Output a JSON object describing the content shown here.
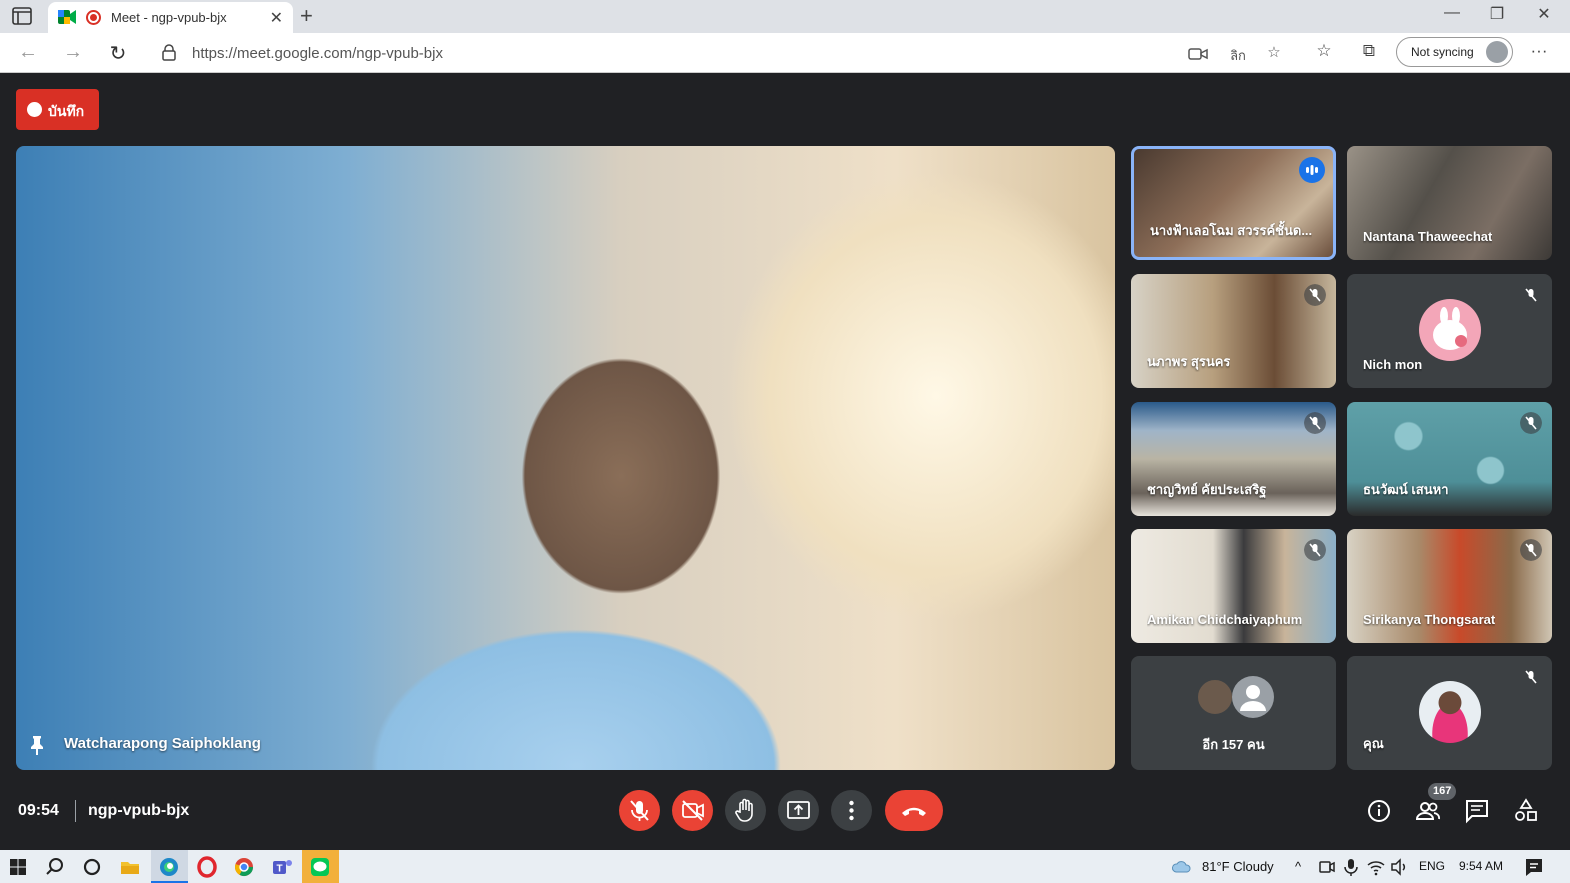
{
  "browser": {
    "tab_title": "Meet - ngp-vpub-bjx",
    "new_tab_label": "+",
    "url": "https://meet.google.com/ngp-vpub-bjx",
    "sync_label": "Not syncing",
    "min_label": "—",
    "max_label": "❐",
    "close_label": "✕",
    "translate_label": "ลิก",
    "more_label": "···"
  },
  "meeting": {
    "recording_label": "บันทึก",
    "main_speaker": "Watcharapong Saiphoklang",
    "time": "09:54",
    "code": "ngp-vpub-bjx",
    "participant_count": "167"
  },
  "participants": [
    {
      "name": "นางฟ้าเลอโฉม สวรรค์ชั้นด...",
      "status": "speaking",
      "bg": "#7a5c48"
    },
    {
      "name": "Nantana Thaweechat",
      "status": "none",
      "bg": "#6b6258"
    },
    {
      "name": "นภาพร สุรนคร",
      "status": "muted",
      "bg": "#9d8a70"
    },
    {
      "name": "Nich mon",
      "status": "muted",
      "bg": "#3c4043"
    },
    {
      "name": "ชาญวิทย์ คัยประเสริฐ",
      "status": "muted",
      "bg": "#8b8d86"
    },
    {
      "name": "ธนวัฒน์ เสนหา",
      "status": "muted",
      "bg": "#5fa0a8"
    },
    {
      "name": "Amikan Chidchaiyaphum",
      "status": "muted",
      "bg": "#c9c2b6"
    },
    {
      "name": "Sirikanya Thongsarat",
      "status": "muted",
      "bg": "#a68a6c"
    }
  ],
  "more_tile": {
    "label": "อีก 157 คน"
  },
  "self_tile": {
    "name": "คุณ"
  },
  "taskbar": {
    "weather": "81°F  Cloudy",
    "lang": "ENG",
    "clock": "9:54 AM"
  },
  "colors": {
    "accent": "#1a73e8",
    "danger": "#ea4335",
    "recording": "#d93025"
  }
}
